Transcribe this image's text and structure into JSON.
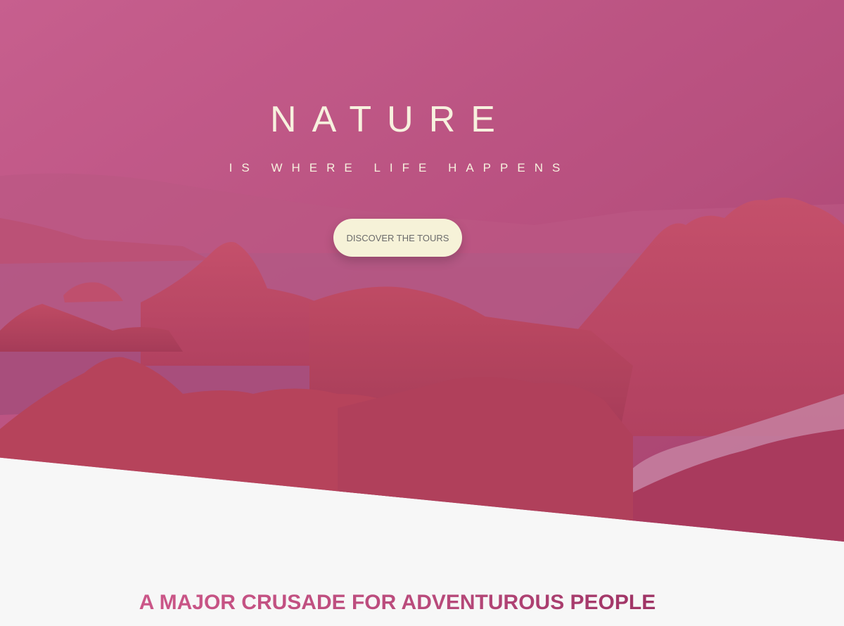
{
  "hero": {
    "title": "NATURE",
    "subtitle": "IS WHERE LIFE HAPPENS",
    "cta_label": "DISCOVER THE TOURS"
  },
  "about": {
    "heading": "A MAJOR CRUSADE FOR ADVENTUROUS PEOPLE"
  },
  "colors": {
    "overlay_start": "#c95f95",
    "overlay_end": "#a63f6e",
    "button_bg": "#f6f2d8",
    "heading_gradient_start": "#d45c8e",
    "heading_gradient_end": "#8e2456"
  }
}
